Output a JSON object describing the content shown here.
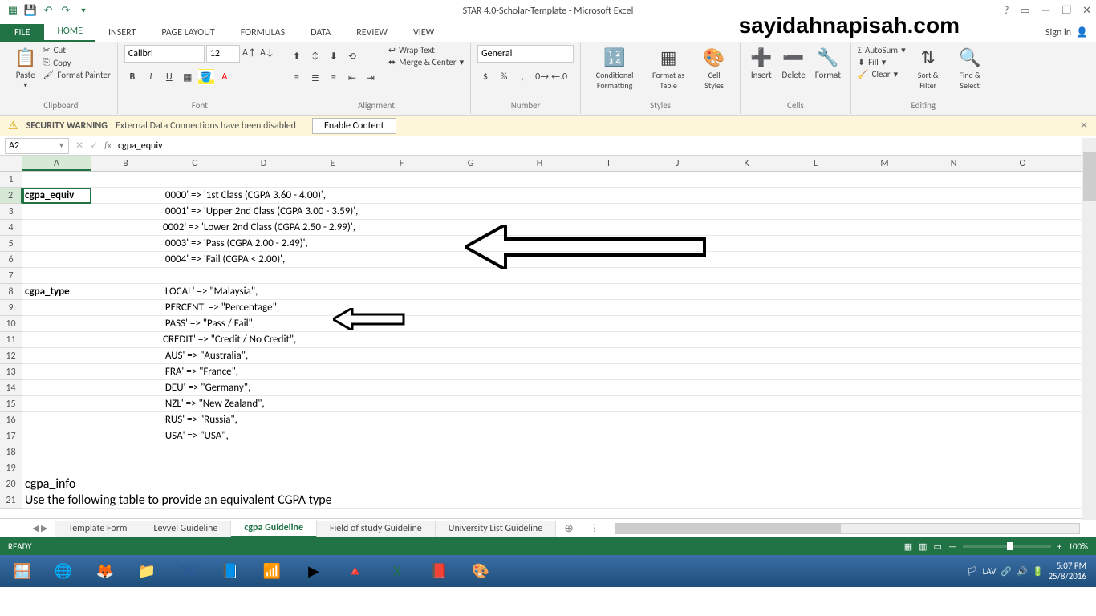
{
  "app": {
    "title": "STAR 4.0-Scholar-Template - Microsoft Excel",
    "watermark": "sayidahnapisah.com"
  },
  "titlebar_right": {
    "help": "?",
    "ribbon_opts": "▭",
    "min": "—",
    "restore": "❐",
    "close": "✕"
  },
  "tabs": {
    "file": "FILE",
    "items": [
      "HOME",
      "INSERT",
      "PAGE LAYOUT",
      "FORMULAS",
      "DATA",
      "REVIEW",
      "VIEW"
    ],
    "active": 0,
    "signin": "Sign in"
  },
  "ribbon": {
    "clipboard": {
      "paste": "Paste",
      "cut": "Cut",
      "copy": "Copy",
      "format_painter": "Format Painter",
      "label": "Clipboard"
    },
    "font": {
      "name": "Calibri",
      "size": "12",
      "label": "Font"
    },
    "alignment": {
      "wrap": "Wrap Text",
      "merge": "Merge & Center",
      "label": "Alignment"
    },
    "number": {
      "format": "General",
      "label": "Number"
    },
    "styles": {
      "cond": "Conditional Formatting",
      "table": "Format as Table",
      "cell": "Cell Styles",
      "label": "Styles"
    },
    "cells": {
      "insert": "Insert",
      "delete": "Delete",
      "format": "Format",
      "label": "Cells"
    },
    "editing": {
      "autosum": "AutoSum",
      "fill": "Fill",
      "clear": "Clear",
      "sort": "Sort & Filter",
      "find": "Find & Select",
      "label": "Editing"
    }
  },
  "security": {
    "title": "SECURITY WARNING",
    "msg": "External Data Connections have been disabled",
    "btn": "Enable Content"
  },
  "formula_bar": {
    "ref": "A2",
    "value": "cgpa_equiv"
  },
  "columns": [
    "A",
    "B",
    "C",
    "D",
    "E",
    "F",
    "G",
    "H",
    "I",
    "J",
    "K",
    "L",
    "M",
    "N",
    "O"
  ],
  "rows_visible": 21,
  "selected_cell": {
    "col": 0,
    "row": 2
  },
  "cells": {
    "A2": {
      "v": "cgpa_equiv",
      "bold": true
    },
    "C2": {
      "v": "'0000' => '1st Class (CGPA 3.60 - 4.00)',"
    },
    "C3": {
      "v": "'0001' => 'Upper 2nd Class (CGPA 3.00 - 3.59)',"
    },
    "C4": {
      "v": "0002' => 'Lower 2nd Class (CGPA 2.50 - 2.99)',"
    },
    "C5": {
      "v": "'0003' => 'Pass (CGPA 2.00 - 2.49)',"
    },
    "C6": {
      "v": "'0004' => 'Fail (CGPA < 2.00)',"
    },
    "A8": {
      "v": "cgpa_type",
      "bold": true
    },
    "C8": {
      "v": "'LOCAL'   => \"Malaysia\","
    },
    "C9": {
      "v": "'PERCENT' => \"Percentage\","
    },
    "C10": {
      "v": "'PASS'    => \"Pass / Fail\","
    },
    "C11": {
      "v": "CREDIT'  => \"Credit / No Credit\","
    },
    "C12": {
      "v": "'AUS'    => \"Australia\","
    },
    "C13": {
      "v": "'FRA'    => \"France\","
    },
    "C14": {
      "v": "'DEU'    => \"Germany\","
    },
    "C15": {
      "v": "'NZL'    => \"New Zealand\","
    },
    "C16": {
      "v": "'RUS'    => \"Russia\","
    },
    "C17": {
      "v": "'USA'    => \"USA\","
    },
    "A20": {
      "v": "cgpa_info",
      "large": true
    },
    "A21": {
      "v": "Use the following table to provide an equivalent CGPA type",
      "large": true
    }
  },
  "sheets": {
    "items": [
      "Template Form",
      "Levvel Guideline",
      "cgpa Guideline",
      "Field of study Guideline",
      "University List Guideline"
    ],
    "active": 2
  },
  "status": {
    "ready": "READY",
    "zoom": "100%"
  },
  "taskbar": {
    "time": "5:07 PM",
    "date": "25/8/2016"
  }
}
